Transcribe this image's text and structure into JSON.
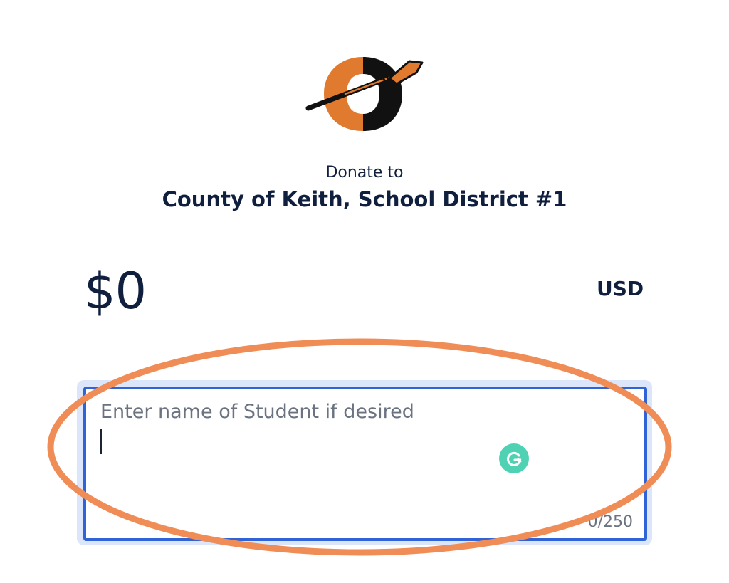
{
  "header": {
    "donate_label": "Donate to",
    "organization": "County of Keith, School District #1"
  },
  "amount": {
    "value": "$0",
    "currency": "USD"
  },
  "student_field": {
    "placeholder": "Enter name of Student if desired",
    "counter": "0/250"
  },
  "colors": {
    "accent_border": "#2f63d6",
    "focus_halo": "#dbe6fb",
    "annotation": "#f08c55",
    "logo_orange": "#e07a2e",
    "logo_black": "#111111",
    "grammarly": "#15c39a",
    "text": "#0f1f3d"
  },
  "icons": {
    "logo": "district-logo-icon",
    "grammarly": "grammarly-icon"
  }
}
